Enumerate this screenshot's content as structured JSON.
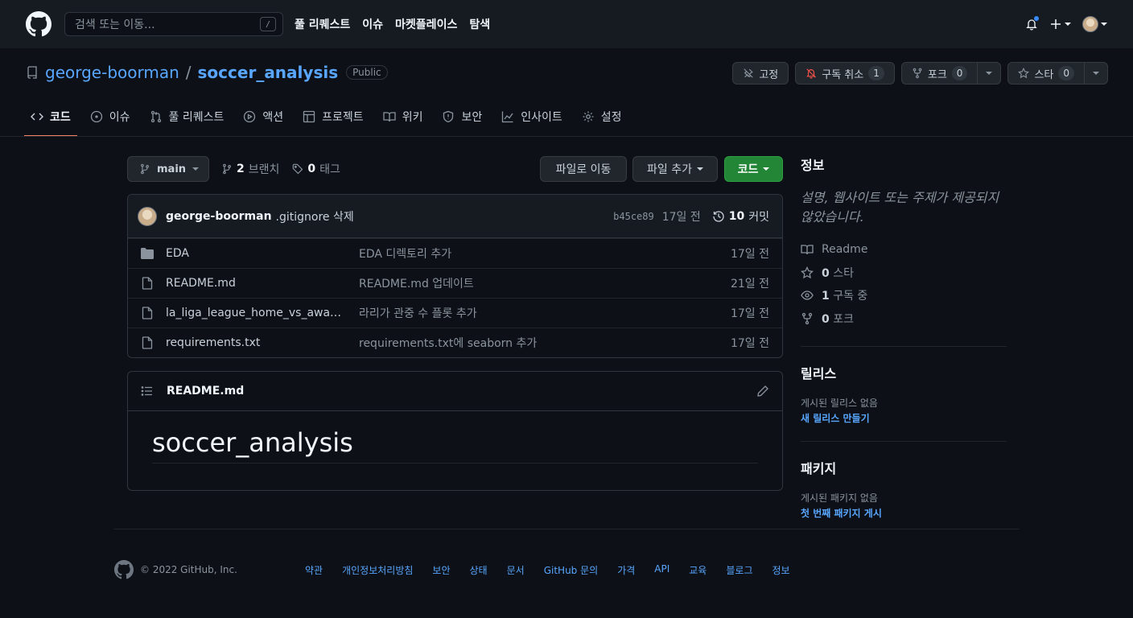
{
  "header": {
    "search_placeholder": "검색 또는 이동...",
    "slash_key": "/",
    "nav": [
      "풀 리퀘스트",
      "이슈",
      "마켓플레이스",
      "탐색"
    ]
  },
  "repo": {
    "owner": "george-boorman",
    "separator": "/",
    "name": "soccer_analysis",
    "visibility": "Public",
    "actions": {
      "pin_label": "고정",
      "unwatch_label": "구독 취소",
      "unwatch_count": "1",
      "fork_label": "포크",
      "fork_count": "0",
      "star_label": "스타",
      "star_count": "0"
    }
  },
  "tabs": [
    "코드",
    "이슈",
    "풀 리퀘스트",
    "액션",
    "프로젝트",
    "위키",
    "보안",
    "인사이트",
    "설정"
  ],
  "toolbar": {
    "branch": "main",
    "branches_count": "2",
    "branches_label": "브랜치",
    "tags_count": "0",
    "tags_label": "태그",
    "goto_file": "파일로 이동",
    "add_file": "파일 추가",
    "code": "코드"
  },
  "latest_commit": {
    "author": "george-boorman",
    "message": ".gitignore 삭제",
    "sha": "b45ce89",
    "age": "17일 전",
    "commits_count": "10",
    "commits_label": "커밋"
  },
  "files": [
    {
      "type": "folder",
      "name": "EDA",
      "commit": "EDA 디렉토리 추가",
      "age": "17일 전"
    },
    {
      "type": "file",
      "name": "README.md",
      "commit": "README.md 업데이트",
      "age": "21일 전"
    },
    {
      "type": "file",
      "name": "la_liga_league_home_vs_away_att...",
      "commit": "라리가 관중 수 플롯 추가",
      "age": "17일 전"
    },
    {
      "type": "file",
      "name": "requirements.txt",
      "commit": "requirements.txt에 seaborn 추가",
      "age": "17일 전"
    }
  ],
  "readme": {
    "filename": "README.md",
    "heading": "soccer_analysis"
  },
  "sidebar": {
    "about_title": "정보",
    "about_desc": "설명, 웹사이트 또는 주제가 제공되지 않았습니다.",
    "readme": "Readme",
    "stars_count": "0",
    "stars_label": "스타",
    "watching_count": "1",
    "watching_label": "구독 중",
    "forks_count": "0",
    "forks_label": "포크",
    "releases_title": "릴리스",
    "releases_none": "게시된 릴리스 없음",
    "releases_create": "새 릴리스 만들기",
    "packages_title": "패키지",
    "packages_none": "게시된 패키지 없음",
    "packages_publish": "첫 번째 패키지 게시"
  },
  "footer": {
    "copyright": "© 2022 GitHub, Inc.",
    "links": [
      "약관",
      "개인정보처리방침",
      "보안",
      "상태",
      "문서",
      "GitHub 문의",
      "가격",
      "API",
      "교육",
      "블로그",
      "정보"
    ]
  },
  "colors": {
    "accent_link": "#58a6ff",
    "primary_button": "#238636",
    "active_tab_underline": "#f78166"
  }
}
